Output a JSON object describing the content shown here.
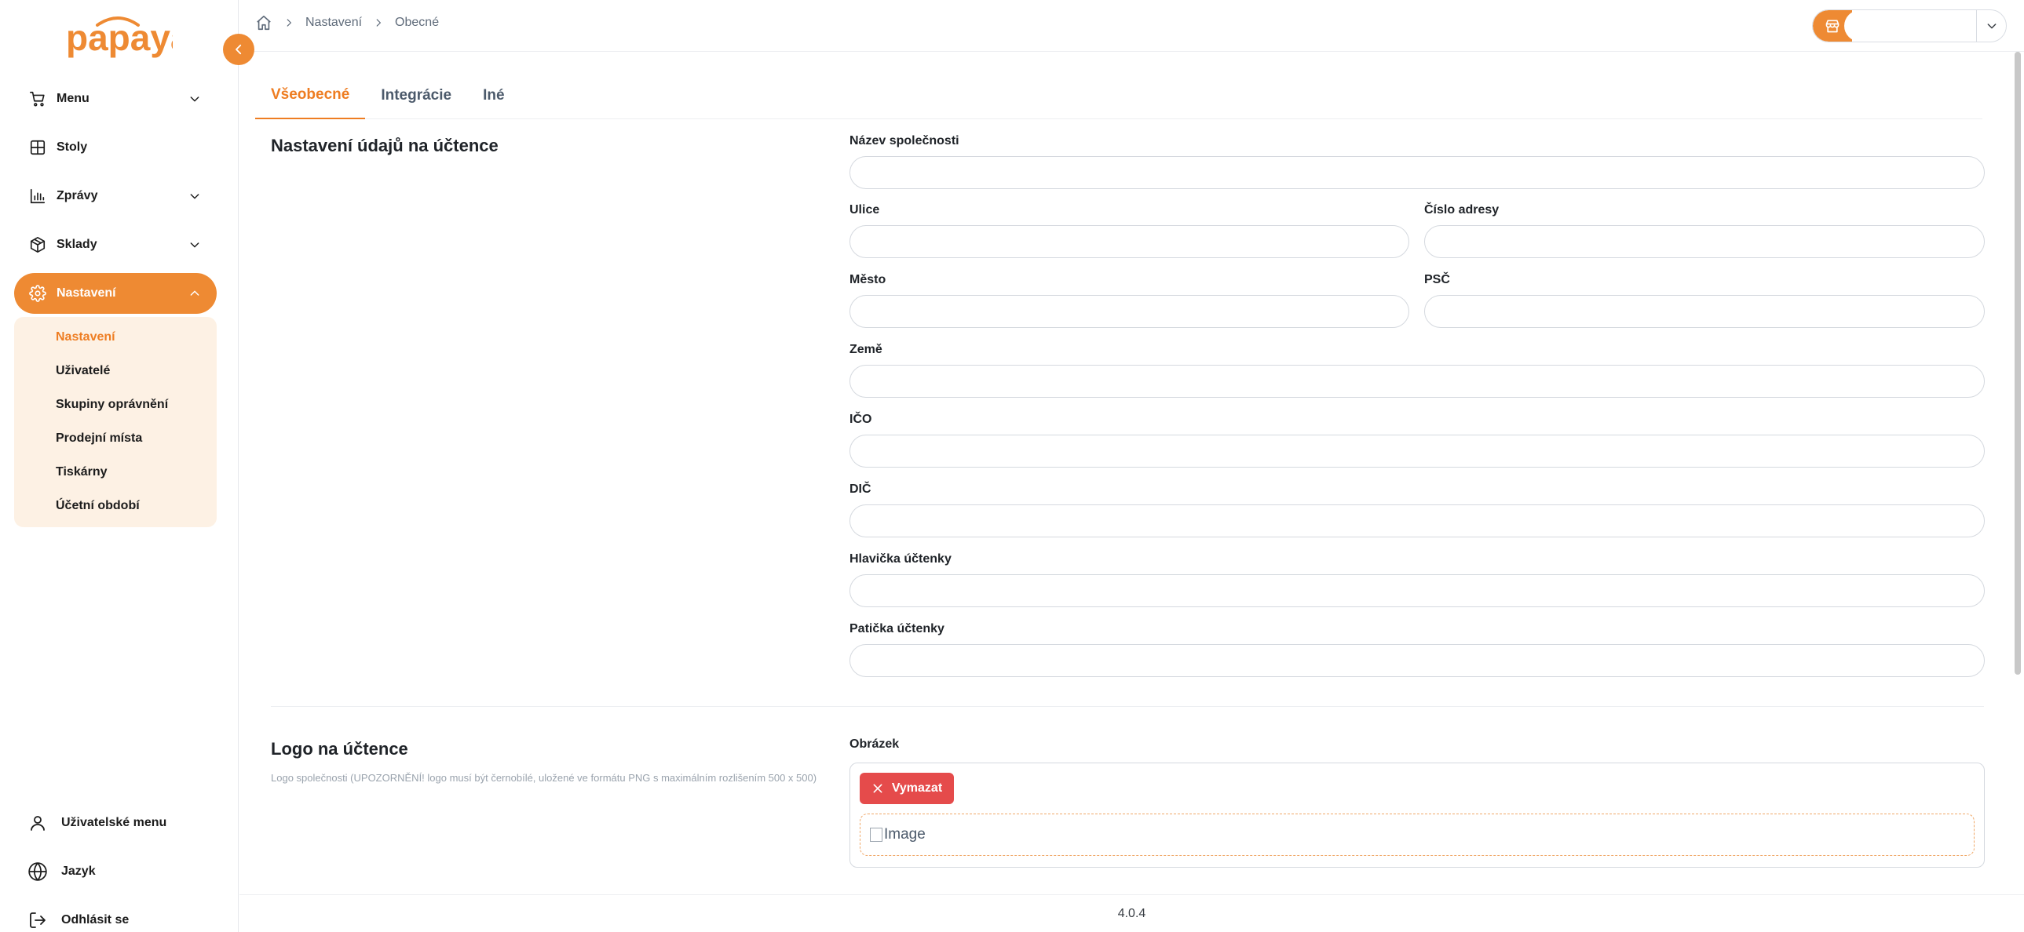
{
  "brand": {
    "logo_text": "papaya",
    "accent": "#ee8a33"
  },
  "sidebar": {
    "items": [
      {
        "label": "Menu",
        "icon": "cart-icon",
        "has_chevron": true
      },
      {
        "label": "Stoly",
        "icon": "table-grid-icon",
        "has_chevron": false
      },
      {
        "label": "Zprávy",
        "icon": "bar-chart-icon",
        "has_chevron": true
      },
      {
        "label": "Sklady",
        "icon": "box-icon",
        "has_chevron": true
      },
      {
        "label": "Nastavení",
        "icon": "gear-icon",
        "has_chevron": true,
        "expanded": true
      }
    ],
    "submenu": [
      {
        "label": "Nastavení",
        "active": true
      },
      {
        "label": "Uživatelé"
      },
      {
        "label": "Skupiny oprávnění"
      },
      {
        "label": "Prodejní místa"
      },
      {
        "label": "Tiskárny"
      },
      {
        "label": "Účetní období"
      }
    ],
    "bottom": [
      {
        "label": "Uživatelské menu",
        "icon": "user-icon"
      },
      {
        "label": "Jazyk",
        "icon": "globe-icon"
      },
      {
        "label": "Odhlásit se",
        "icon": "logout-icon"
      }
    ]
  },
  "breadcrumb": {
    "items": [
      "Nastavení",
      "Obecné"
    ]
  },
  "shop_select": {
    "value": ""
  },
  "tabs": [
    {
      "label": "Všeobecné",
      "active": true
    },
    {
      "label": "Integrácie"
    },
    {
      "label": "Iné"
    }
  ],
  "receipt_section": {
    "title": "Nastavení údajů na účtence",
    "fields": {
      "company_name": {
        "label": "Název společnosti",
        "value": ""
      },
      "street": {
        "label": "Ulice",
        "value": ""
      },
      "address_number": {
        "label": "Číslo adresy",
        "value": ""
      },
      "city": {
        "label": "Město",
        "value": ""
      },
      "zip": {
        "label": "PSČ",
        "value": ""
      },
      "country": {
        "label": "Země",
        "value": ""
      },
      "ico": {
        "label": "IČO",
        "value": ""
      },
      "dic": {
        "label": "DIČ",
        "value": ""
      },
      "header": {
        "label": "Hlavička účtenky",
        "value": ""
      },
      "footer": {
        "label": "Patička účtenky",
        "value": ""
      }
    }
  },
  "logo_section": {
    "title": "Logo na účtence",
    "description": "Logo společnosti (UPOZORNĚNÍ! logo musí být černobílé, uložené ve formátu PNG s maximálním rozlišením 500 x 500)",
    "image_label": "Obrázek",
    "delete_label": "Vymazat",
    "image_alt": "Image"
  },
  "footer": {
    "version": "4.0.4"
  }
}
